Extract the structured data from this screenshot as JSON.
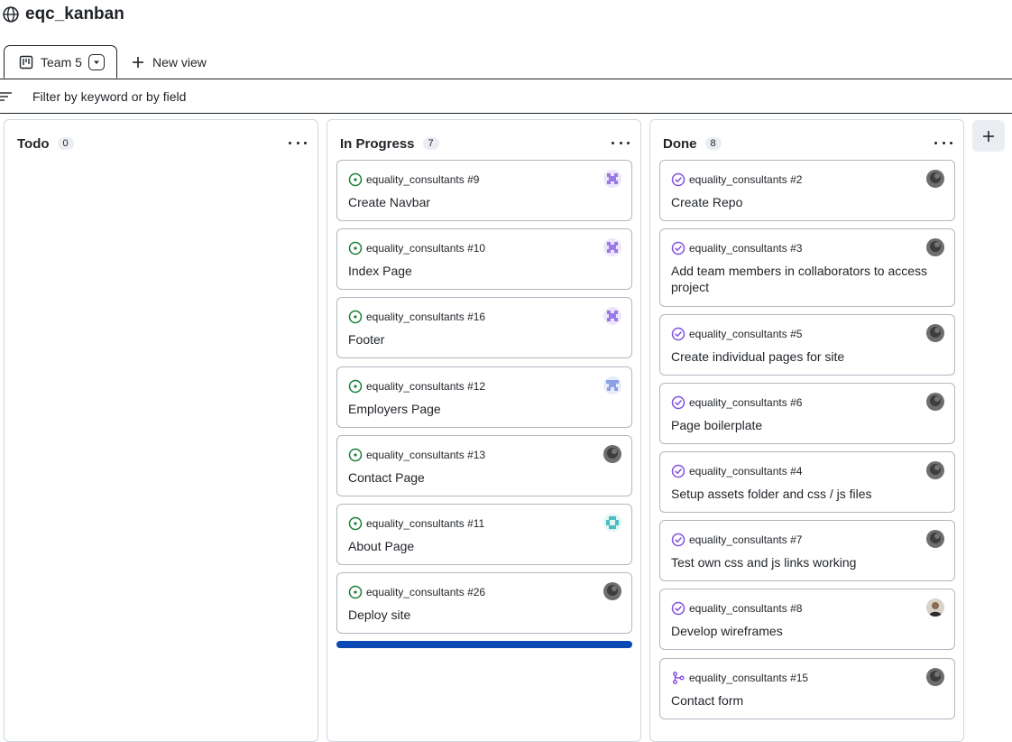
{
  "project": {
    "title": "eqc_kanban"
  },
  "view_tabs": [
    {
      "label": "Team 5",
      "icon": "project-board-icon"
    }
  ],
  "new_view": {
    "label": "New view",
    "icon": "plus-icon"
  },
  "filter": {
    "placeholder": "Filter by keyword or by field",
    "icon": "filter-icon"
  },
  "colors": {
    "open": "#1a7f37",
    "done": "#8250df",
    "drop_indicator": "#0a49b3",
    "add_column_bg": "#eaeef2"
  },
  "columns": [
    {
      "title": "Todo",
      "count": "0",
      "cards": []
    },
    {
      "title": "In Progress",
      "count": "7",
      "cards": [
        {
          "repo": "equality_consultants #9",
          "title": "Create Navbar",
          "status": "open-issue-icon",
          "avatar": "identicon-purple"
        },
        {
          "repo": "equality_consultants #10",
          "title": "Index Page",
          "status": "open-issue-icon",
          "avatar": "identicon-purple"
        },
        {
          "repo": "equality_consultants #16",
          "title": "Footer",
          "status": "open-issue-icon",
          "avatar": "identicon-purple"
        },
        {
          "repo": "equality_consultants #12",
          "title": "Employers Page",
          "status": "open-issue-icon",
          "avatar": "identicon-blue"
        },
        {
          "repo": "equality_consultants #13",
          "title": "Contact Page",
          "status": "open-issue-icon",
          "avatar": "photo-grey"
        },
        {
          "repo": "equality_consultants #11",
          "title": "About Page",
          "status": "open-issue-icon",
          "avatar": "identicon-teal"
        },
        {
          "repo": "equality_consultants #26",
          "title": "Deploy site",
          "status": "open-issue-icon",
          "avatar": "photo-grey"
        }
      ]
    },
    {
      "title": "Done",
      "count": "8",
      "cards": [
        {
          "repo": "equality_consultants #2",
          "title": "Create Repo",
          "status": "closed-issue-icon",
          "avatar": "photo-grey"
        },
        {
          "repo": "equality_consultants #3",
          "title": "Add team members in collaborators to access project",
          "status": "closed-issue-icon",
          "avatar": "photo-grey"
        },
        {
          "repo": "equality_consultants #5",
          "title": "Create individual pages for site",
          "status": "closed-issue-icon",
          "avatar": "photo-grey"
        },
        {
          "repo": "equality_consultants #6",
          "title": "Page boilerplate",
          "status": "closed-issue-icon",
          "avatar": "photo-grey"
        },
        {
          "repo": "equality_consultants #4",
          "title": "Setup assets folder and css / js files",
          "status": "closed-issue-icon",
          "avatar": "photo-grey"
        },
        {
          "repo": "equality_consultants #7",
          "title": "Test own css and js links working",
          "status": "closed-issue-icon",
          "avatar": "photo-grey"
        },
        {
          "repo": "equality_consultants #8",
          "title": "Develop wireframes",
          "status": "closed-issue-icon",
          "avatar": "photo-person"
        },
        {
          "repo": "equality_consultants #15",
          "title": "Contact form",
          "status": "merged-pr-icon",
          "avatar": "photo-grey"
        }
      ]
    }
  ],
  "add_column": {
    "icon": "plus-icon"
  }
}
